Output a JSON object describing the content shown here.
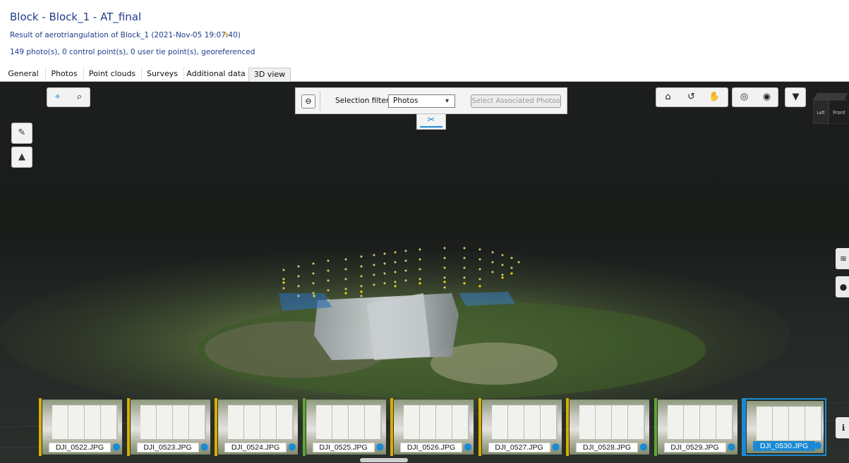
{
  "header": {
    "title": "Block - Block_1 - AT_final",
    "subtitle": "Result of aerotriangulation of Block_1 (2021-Nov-05 19:07:40)",
    "stats": "149 photo(s), 0 control point(s), 0 user tie point(s), georeferenced"
  },
  "tabs": [
    {
      "label": "General"
    },
    {
      "label": "Photos"
    },
    {
      "label": "Point clouds"
    },
    {
      "label": "Surveys"
    },
    {
      "label": "Additional data"
    },
    {
      "label": "3D view",
      "active": true
    }
  ],
  "toolbar_left": {
    "buttons": [
      "select-icon",
      "search-icon"
    ]
  },
  "side_left": {
    "buttons": [
      "measure-icon",
      "chart-icon"
    ]
  },
  "selection_panel": {
    "label": "Selection filter:",
    "filter_value": "Photos",
    "associated_button": "Select Associated Photos",
    "tools_tab_icon": "tools-icon"
  },
  "toolbar_right": {
    "buttons": [
      "home-icon",
      "rotate-icon",
      "pan-icon",
      "focus-icon",
      "visibility-icon",
      "filter-icon"
    ]
  },
  "view_cube": {
    "left": "Left",
    "front": "Front"
  },
  "right_panel": {
    "buttons": [
      "layers-icon",
      "globe-icon",
      "info-icon"
    ]
  },
  "photos": [
    {
      "name": "DJI_0522.JPG",
      "color": "#d4b000"
    },
    {
      "name": "DJI_0523.JPG",
      "color": "#d4b000"
    },
    {
      "name": "DJI_0524.JPG",
      "color": "#d4b000"
    },
    {
      "name": "DJI_0525.JPG",
      "color": "#5ca832"
    },
    {
      "name": "DJI_0526.JPG",
      "color": "#d4b000"
    },
    {
      "name": "DJI_0527.JPG",
      "color": "#d4b000"
    },
    {
      "name": "DJI_0528.JPG",
      "color": "#d4b000"
    },
    {
      "name": "DJI_0529.JPG",
      "color": "#5ca832"
    },
    {
      "name": "DJI_0530.JPG",
      "color": "#1a8ad4",
      "selected": true
    }
  ],
  "colors": {
    "accent": "#1a8ad4",
    "title": "#1f3d8c"
  }
}
